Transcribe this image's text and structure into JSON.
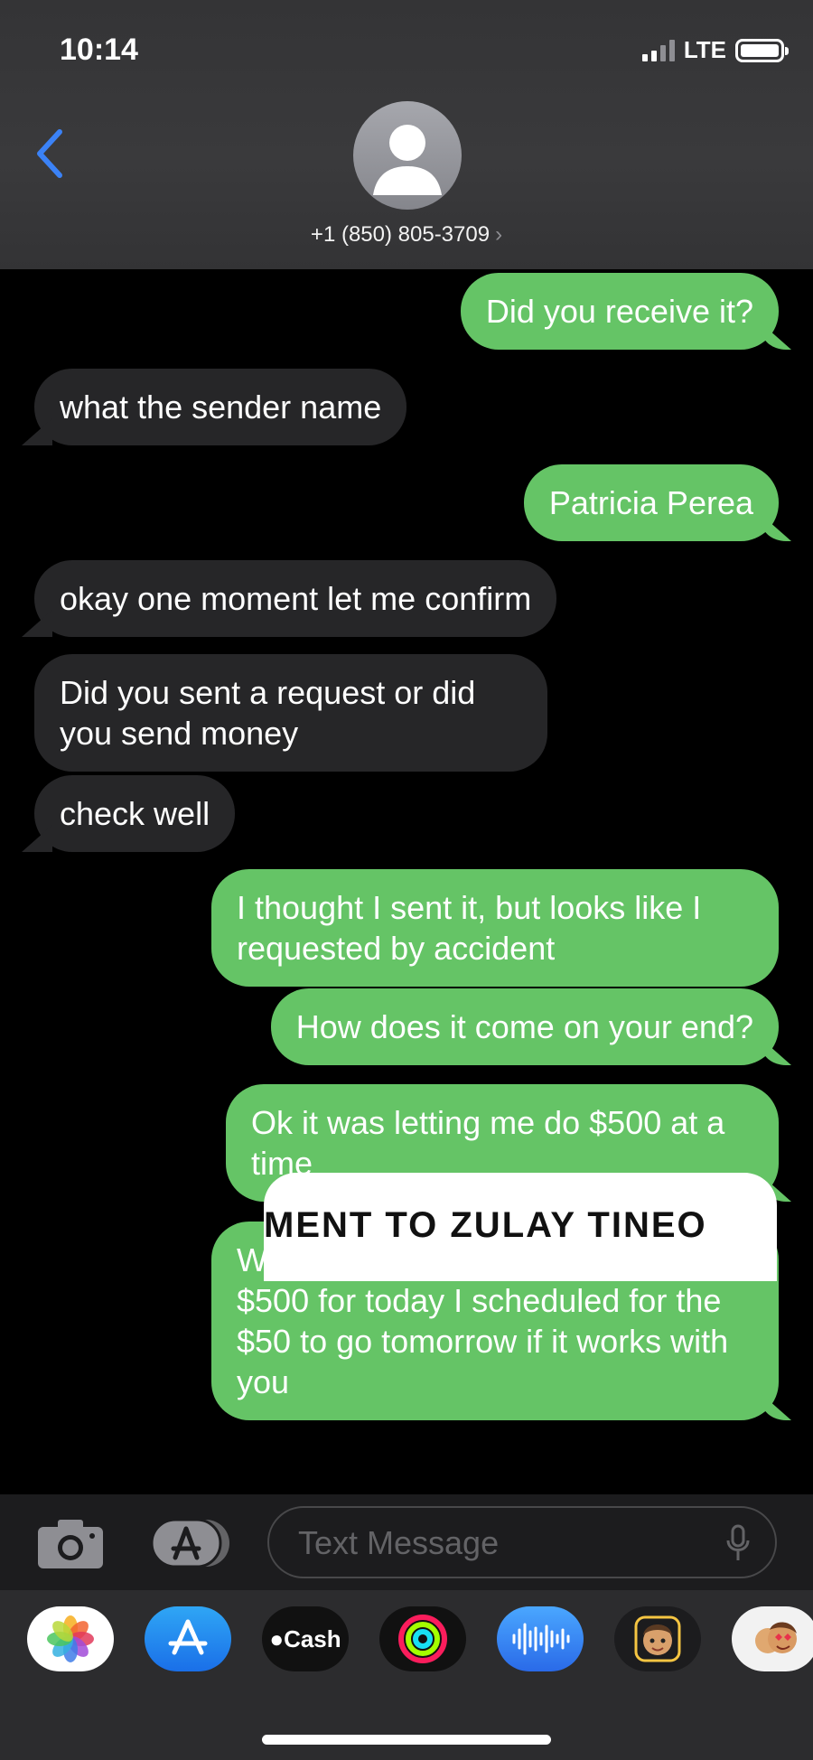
{
  "status": {
    "time": "10:14",
    "network": "LTE"
  },
  "contact": {
    "name": "+1 (850) 805-3709",
    "chevron": "›"
  },
  "messages": [
    {
      "dir": "out",
      "text": "Did you receive it?"
    },
    {
      "dir": "in",
      "text": "what the sender name"
    },
    {
      "dir": "out",
      "text": "Patricia Perea"
    },
    {
      "dir": "in",
      "text": "okay one moment let me confirm"
    },
    {
      "dir": "in",
      "text": "Did you sent a request or did you send money"
    },
    {
      "dir": "in",
      "text": "check well"
    },
    {
      "dir": "out",
      "text": "I thought I sent it, but looks like I requested by accident"
    },
    {
      "dir": "out",
      "text": "How does it come on your end?"
    },
    {
      "dir": "out",
      "text": "Ok it was letting me do $500 at a time"
    },
    {
      "dir": "out",
      "text": "Well it says that the limit to send is $500 for today I scheduled for the $50 to go tomorrow if it works with you"
    }
  ],
  "card_peek_text": "MENT TO ZULAY TINEO",
  "input": {
    "placeholder": "Text Message"
  },
  "drawer": {
    "apps": [
      {
        "icon": "photos-icon"
      },
      {
        "icon": "app-store-icon"
      },
      {
        "icon": "apple-cash-icon",
        "label": "Cash"
      },
      {
        "icon": "activity-icon"
      },
      {
        "icon": "audio-message-icon"
      },
      {
        "icon": "memoji-icon"
      },
      {
        "icon": "memoji-stickers-icon"
      }
    ]
  },
  "colors": {
    "outgoing": "#65c466",
    "incoming": "#262628",
    "accent": "#3b82f6"
  }
}
